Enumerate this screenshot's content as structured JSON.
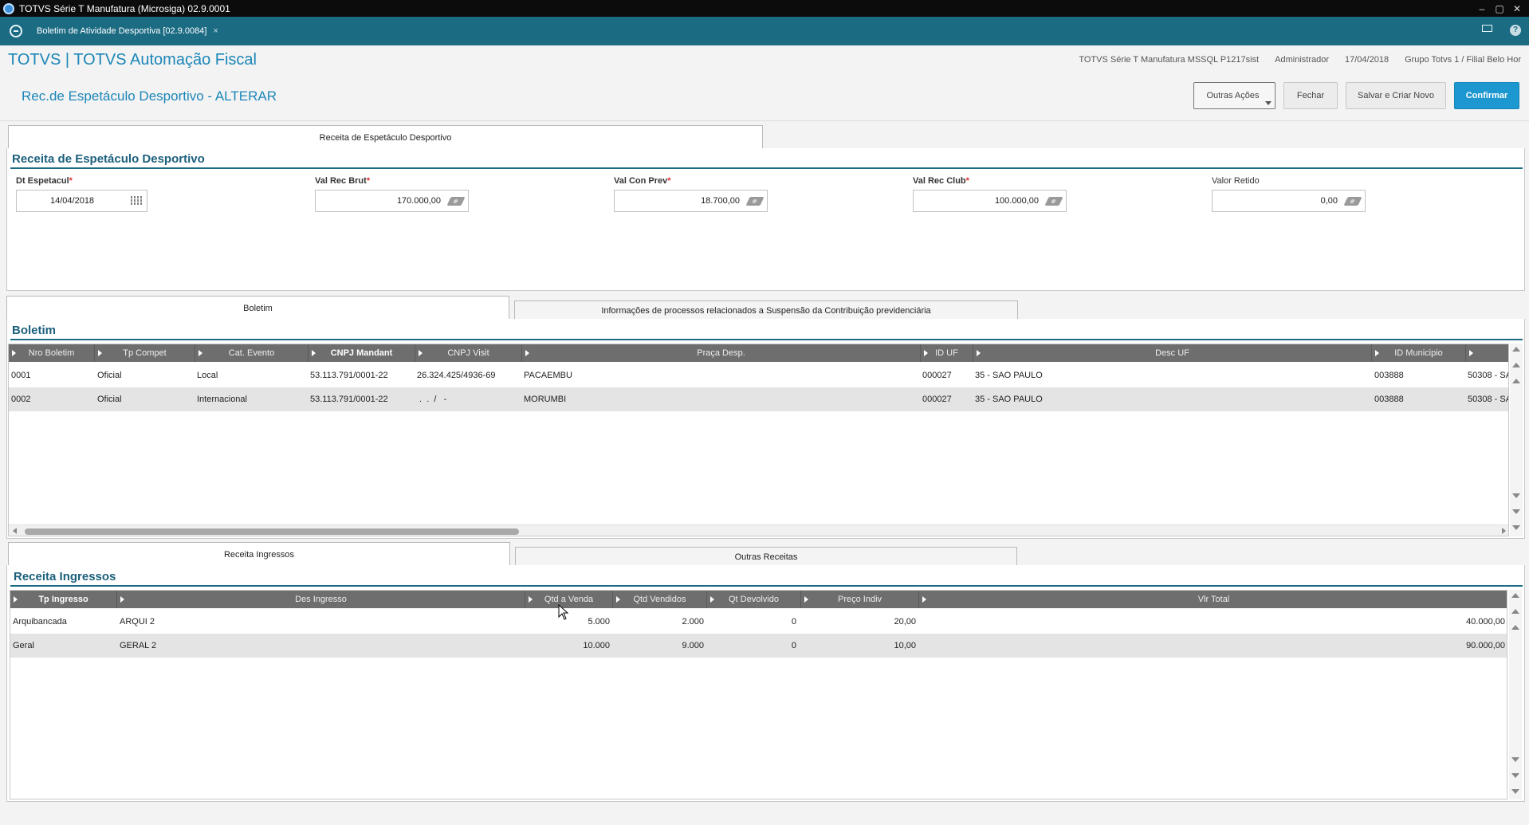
{
  "window": {
    "title": "TOTVS Série T Manufatura (Microsiga) 02.9.0001",
    "controls": [
      "–",
      "▢",
      "✕"
    ]
  },
  "tabstrip": {
    "tab_label": "Boletim de Atividade Desportiva [02.9.0084]",
    "tab_close": "×",
    "help": "?"
  },
  "header": {
    "brand": "TOTVS | TOTVS Automação Fiscal",
    "system": "TOTVS Série T Manufatura MSSQL P1217sist",
    "user": "Administrador",
    "date": "17/04/2018",
    "company": "Grupo Totvs 1 / Filial Belo Hor",
    "page_title": "Rec.de Espetáculo Desportivo - ALTERAR"
  },
  "actions": {
    "outras": "Outras Ações",
    "fechar": "Fechar",
    "salvar_novo": "Salvar e Criar Novo",
    "confirmar": "Confirmar"
  },
  "top_tab": "Receita de Espetáculo Desportivo",
  "form": {
    "section_title": "Receita de Espetáculo Desportivo",
    "required_mark": "*",
    "fields": [
      {
        "label": "Dt Espetacul",
        "value": "14/04/2018"
      },
      {
        "label": "Val Rec Brut",
        "value": "170.000,00"
      },
      {
        "label": "Val Con Prev",
        "value": "18.700,00"
      },
      {
        "label": "Val Rec Club",
        "value": "100.000,00"
      },
      {
        "label": "Valor Retido",
        "value": "0,00"
      }
    ]
  },
  "mid_tabs": {
    "boletim": "Boletim",
    "suspensao": "Informações de processos relacionados a Suspensão da Contribuição previdenciária"
  },
  "boletim": {
    "section_title": "Boletim",
    "columns": [
      "Nro Boletim",
      "Tp Compet",
      "Cat. Evento",
      "CNPJ Mandant",
      "CNPJ Visit",
      "Praça Desp.",
      "ID UF",
      "Desc UF",
      "ID Municipio",
      ""
    ],
    "rows": [
      [
        "0001",
        "Oficial",
        "Local",
        "53.113.791/0001-22",
        "26.324.425/4936-69",
        "PACAEMBU",
        "000027",
        "35 - SAO PAULO",
        "003888",
        "50308 - SA"
      ],
      [
        "0002",
        "Oficial",
        "Internacional",
        "53.113.791/0001-22",
        " .  .  /   -",
        "MORUMBI",
        "000027",
        "35 - SAO PAULO",
        "003888",
        "50308 - SA"
      ]
    ]
  },
  "bottom_tabs": {
    "ingressos": "Receita Ingressos",
    "outras": "Outras Receitas"
  },
  "ingressos": {
    "section_title": "Receita Ingressos",
    "columns": [
      "Tp Ingresso",
      "Des Ingresso",
      "Qtd a Venda",
      "Qtd Vendidos",
      "Qt Devolvido",
      "Preço Indiv",
      "Vlr Total"
    ],
    "rows": [
      [
        "Arquibancada",
        "ARQUI 2",
        "5.000",
        "2.000",
        "0",
        "20,00",
        "40.000,00"
      ],
      [
        "Geral",
        "GERAL 2",
        "10.000",
        "9.000",
        "0",
        "10,00",
        "90.000,00"
      ]
    ]
  }
}
